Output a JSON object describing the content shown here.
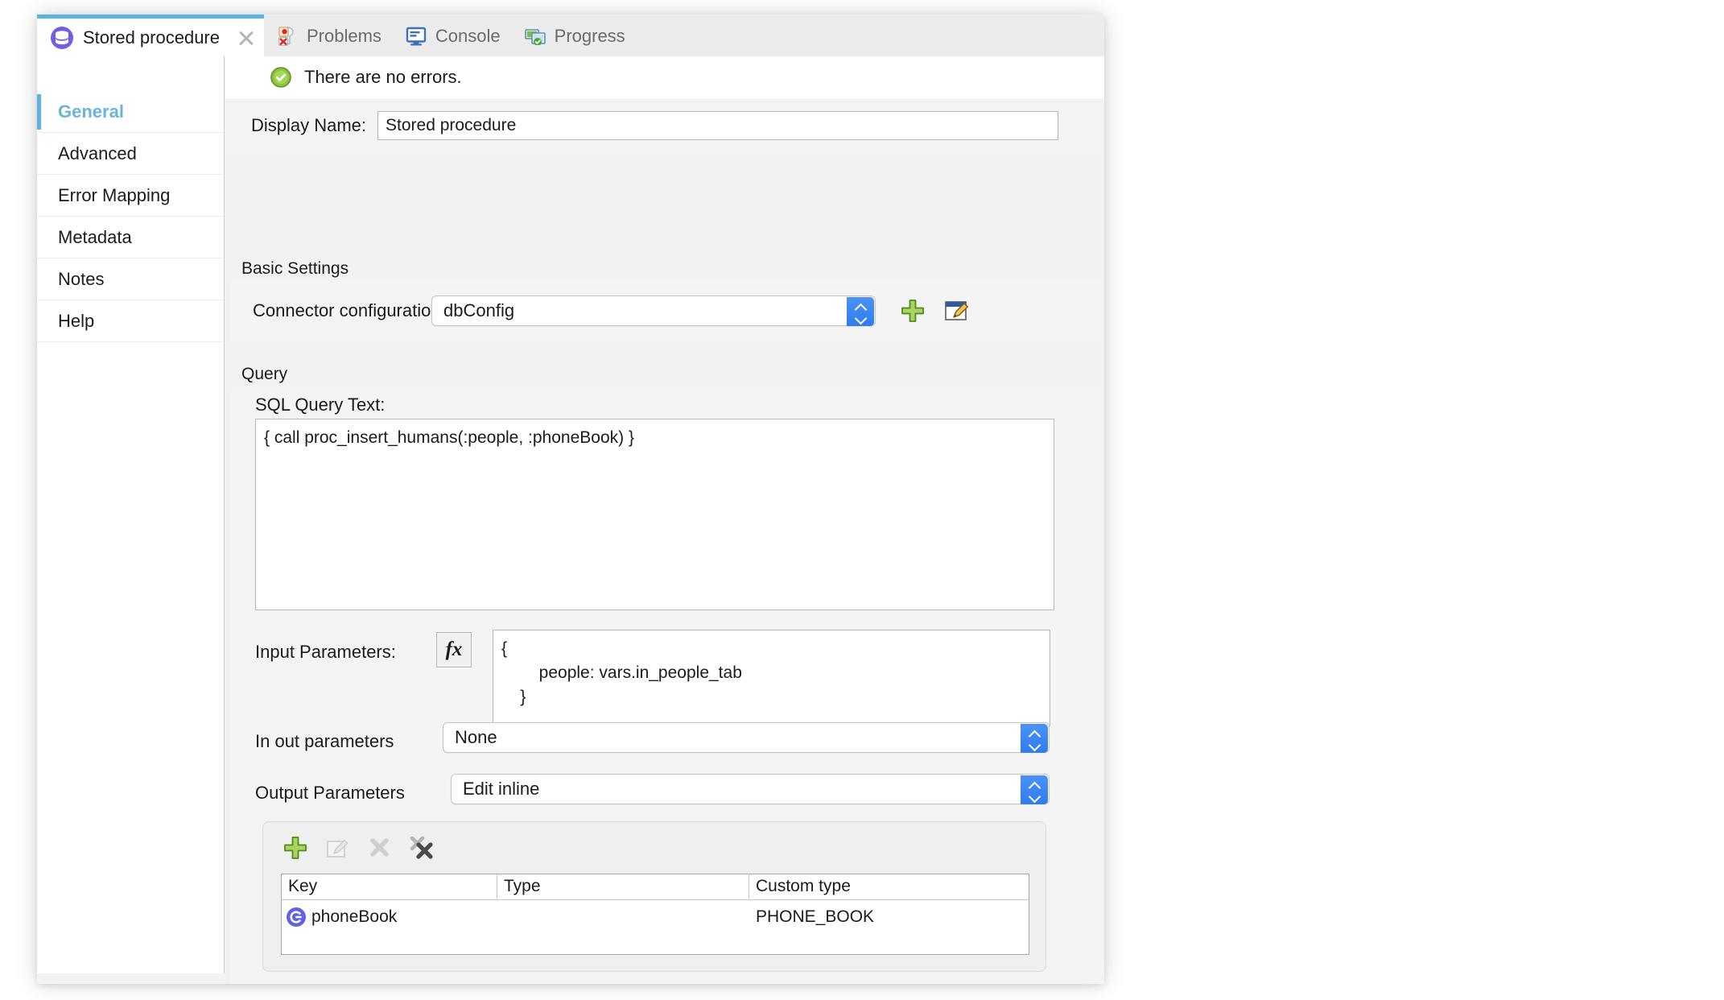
{
  "window": {
    "tabs": [
      {
        "label": "Stored procedure",
        "icon": "database-icon",
        "active": true,
        "closable": true
      },
      {
        "label": "Problems",
        "icon": "problems-icon",
        "active": false,
        "closable": false
      },
      {
        "label": "Console",
        "icon": "console-icon",
        "active": false,
        "closable": false
      },
      {
        "label": "Progress",
        "icon": "progress-icon",
        "active": false,
        "closable": false
      }
    ]
  },
  "sidebar": {
    "items": [
      {
        "label": "General",
        "active": true
      },
      {
        "label": "Advanced",
        "active": false
      },
      {
        "label": "Error Mapping",
        "active": false
      },
      {
        "label": "Metadata",
        "active": false
      },
      {
        "label": "Notes",
        "active": false
      },
      {
        "label": "Help",
        "active": false
      }
    ]
  },
  "status": {
    "icon": "success-check-icon",
    "text": "There are no errors."
  },
  "display_name": {
    "label": "Display Name:",
    "value": "Stored procedure",
    "placeholder": ""
  },
  "basic_settings": {
    "group_label": "Basic Settings",
    "connector": {
      "label": "Connector configuration:",
      "value": "dbConfig",
      "add_icon": "plus-icon",
      "edit_icon": "edit-config-icon"
    }
  },
  "query": {
    "group_label": "Query",
    "sql": {
      "label": "SQL Query Text:",
      "value": "{ call proc_insert_humans(:people, :phoneBook) }"
    },
    "input_parameters": {
      "label": "Input Parameters:",
      "fx_label": "fx",
      "value": "{\n        people: vars.in_people_tab\n    }"
    },
    "in_out_parameters": {
      "label": "In out parameters",
      "value": "None"
    },
    "output_parameters": {
      "label": "Output Parameters",
      "value": "Edit inline"
    },
    "output_table": {
      "toolbar": [
        {
          "name": "add-row-button",
          "icon": "plus-icon",
          "enabled": true
        },
        {
          "name": "edit-row-button",
          "icon": "edit-icon",
          "enabled": false
        },
        {
          "name": "delete-row-button",
          "icon": "close-x-icon",
          "enabled": false
        },
        {
          "name": "delete-all-rows-button",
          "icon": "double-x-icon",
          "enabled": true
        }
      ],
      "columns": [
        "Key",
        "Type",
        "Custom type"
      ],
      "rows": [
        {
          "icon": "key-param-icon",
          "key": "phoneBook",
          "type": "",
          "custom_type": "PHONE_BOOK"
        }
      ]
    }
  },
  "colors": {
    "accent": "#5bb4e5",
    "active_tab_text": "#6ab4dd",
    "panel_bg": "#f2f2f2",
    "band_bg": "#f4f4f4",
    "stepper_blue": "#2f7cf0",
    "plus_green": "#8dc63f",
    "key_icon_purple": "#6161e8",
    "ok_green": "#7cb518"
  }
}
